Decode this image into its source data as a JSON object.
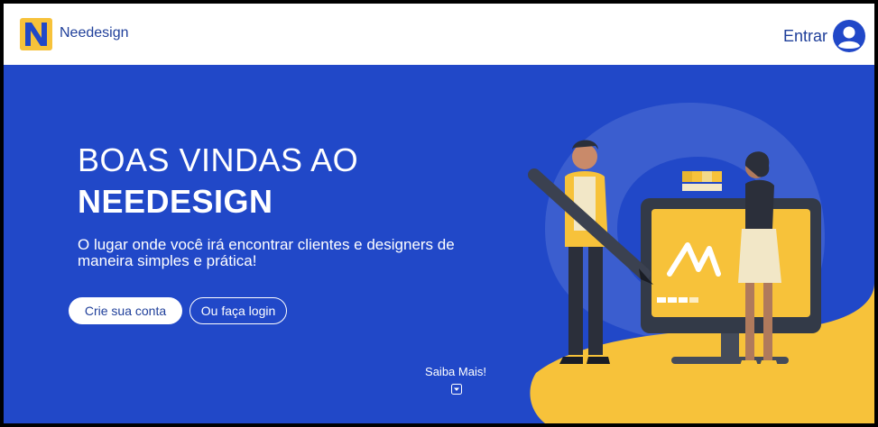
{
  "header": {
    "brand": "Needesign",
    "login_label": "Entrar"
  },
  "hero": {
    "title_line1": "BOAS VINDAS AO",
    "title_line2": "NEEDESIGN",
    "subtitle": "O lugar onde você irá encontrar clientes e designers de maneira simples e prática!",
    "primary_button": "Crie sua conta",
    "secondary_button": "Ou faça login",
    "learn_more": "Saiba Mais!"
  },
  "colors": {
    "brand_blue": "#2148c8",
    "dark_blue": "#1f3f9a",
    "accent_yellow": "#f7c23a"
  },
  "icons": {
    "logo": "needesign-logo",
    "avatar": "user-avatar-icon",
    "learn_more": "chevron-down-box-icon"
  }
}
